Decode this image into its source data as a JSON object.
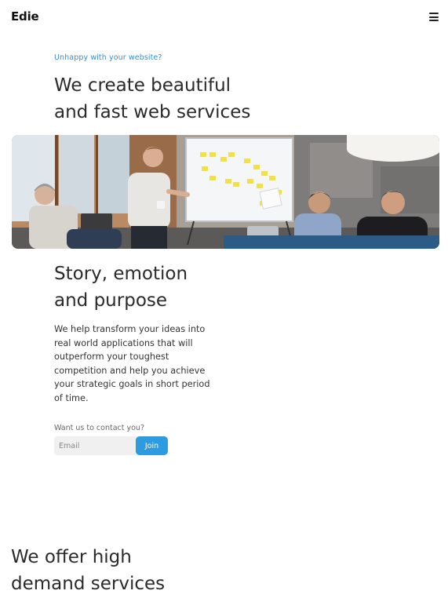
{
  "header": {
    "logo": "Edie",
    "menu_icon": "hamburger-menu-icon"
  },
  "hero": {
    "eyebrow": "Unhappy with your website?",
    "title_line1": "We create beautiful",
    "title_line2": "and fast web services"
  },
  "story": {
    "title_line1": "Story, emotion",
    "title_line2": "and purpose",
    "body": "We help transform your ideas into real world applications that will outperform your toughest competition and help you achieve your strategic goals in short period of time."
  },
  "contact": {
    "label": "Want us to contact you?",
    "email_placeholder": "Email",
    "join_label": "Join"
  },
  "services": {
    "title_line1": "We offer high",
    "title_line2": "demand services"
  },
  "colors": {
    "accent": "#2d9be0",
    "eyebrow": "#2f8fd8",
    "text": "#2a2a2a"
  }
}
